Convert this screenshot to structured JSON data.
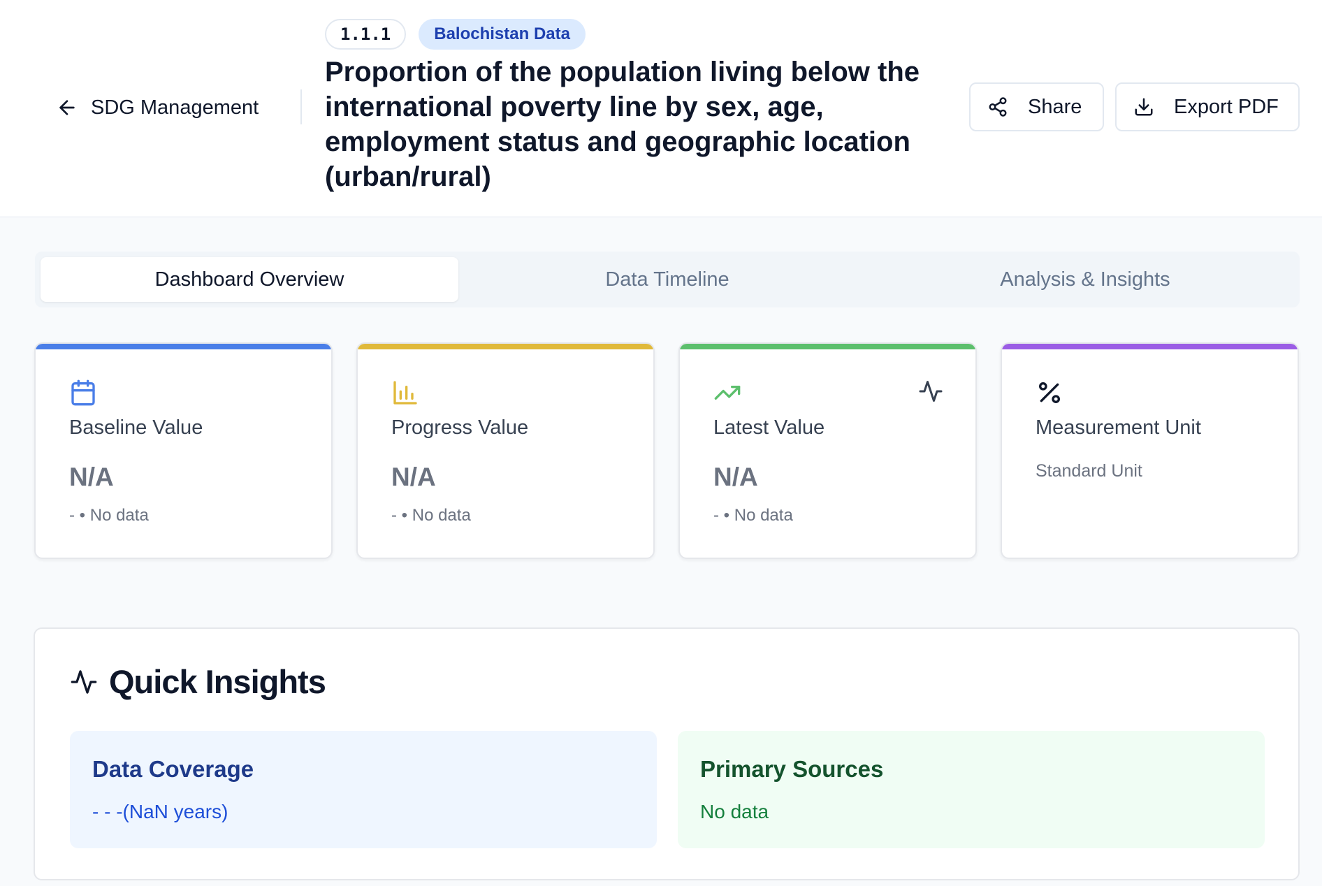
{
  "header": {
    "back_label": "SDG Management",
    "indicator_code": "1.1.1",
    "region_badge": "Balochistan Data",
    "title": "Proportion of the population living below the international poverty line by sex, age, employment status and geographic location (urban/rural)",
    "share_label": "Share",
    "export_label": "Export PDF"
  },
  "tabs": [
    {
      "label": "Dashboard Overview",
      "active": true
    },
    {
      "label": "Data Timeline",
      "active": false
    },
    {
      "label": "Analysis & Insights",
      "active": false
    }
  ],
  "cards": {
    "baseline": {
      "label": "Baseline Value",
      "value": "N/A",
      "note": "- • No data",
      "accent": "#4a7ee8",
      "icon": "calendar-icon"
    },
    "progress": {
      "label": "Progress Value",
      "value": "N/A",
      "note": "- • No data",
      "accent": "#e0b93a",
      "icon": "bar-chart-icon"
    },
    "latest": {
      "label": "Latest Value",
      "value": "N/A",
      "note": "- • No data",
      "accent": "#5cbf6c",
      "icon": "trending-up-icon",
      "side_icon": "activity-icon"
    },
    "unit": {
      "label": "Measurement Unit",
      "value": "Standard Unit",
      "accent": "#9b5de5",
      "icon": "percent-icon"
    }
  },
  "insights": {
    "title": "Quick Insights",
    "coverage": {
      "title": "Data Coverage",
      "value": "- - -(NaN years)"
    },
    "sources": {
      "title": "Primary Sources",
      "value": "No data"
    }
  }
}
